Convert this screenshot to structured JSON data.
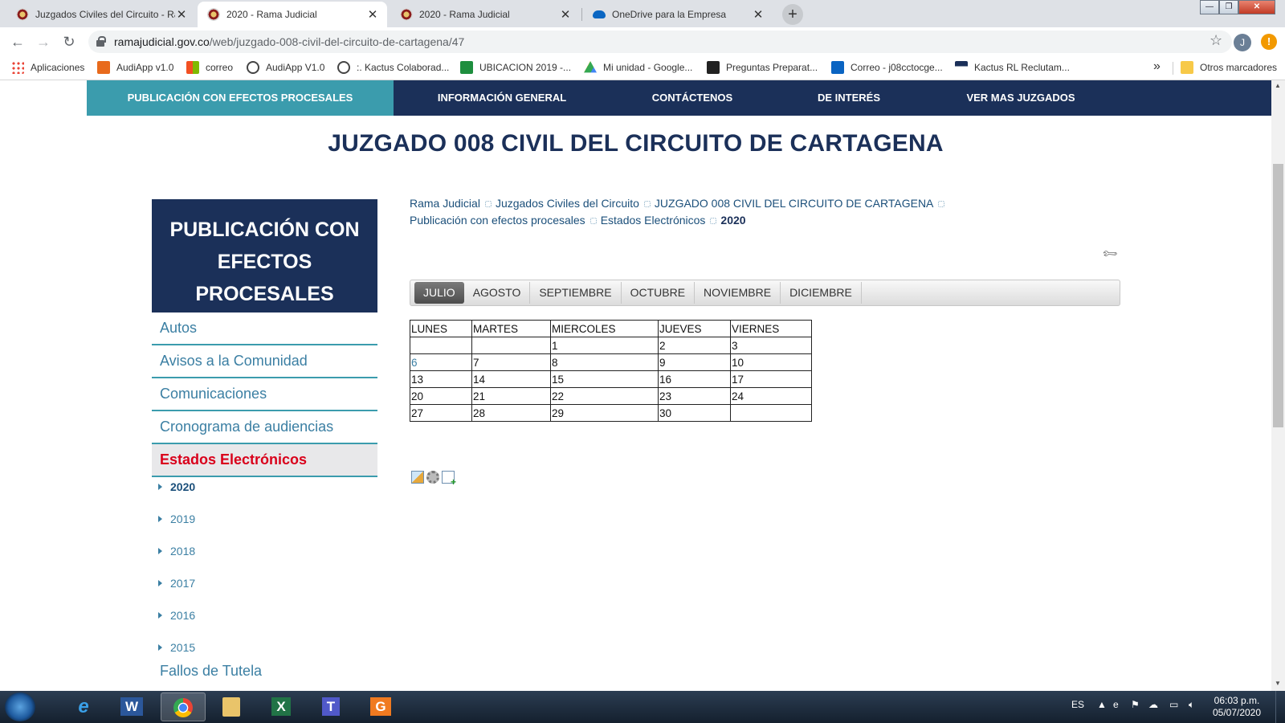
{
  "browser": {
    "tabs": [
      {
        "title": "Juzgados Civiles del Circuito - Ra",
        "active": false
      },
      {
        "title": "2020 - Rama Judicial",
        "active": true
      },
      {
        "title": "2020 - Rama Judicial",
        "active": false
      },
      {
        "title": "OneDrive para la Empresa",
        "active": false
      }
    ],
    "url_host": "ramajudicial.gov.co",
    "url_path": "/web/juzgado-008-civil-del-circuito-de-cartagena/47",
    "profile_initial": "J",
    "update_badge": "!",
    "bookmarks": [
      "Aplicaciones",
      "AudiApp v1.0",
      "correo",
      "AudiApp V1.0",
      ":. Kactus Colaborad...",
      "UBICACION 2019 -...",
      "Mi unidad - Google...",
      "Preguntas Preparat...",
      "Correo - j08cctocge...",
      "Kactus RL Reclutam..."
    ],
    "bookmarks_overflow": "»",
    "other_bookmarks": "Otros marcadores"
  },
  "site": {
    "nav": [
      "PUBLICACIÓN CON EFECTOS PROCESALES",
      "INFORMACIÓN GENERAL",
      "CONTÁCTENOS",
      "DE INTERÉS",
      "VER MAS JUZGADOS"
    ],
    "title": "JUZGADO 008 CIVIL DEL CIRCUITO DE CARTAGENA",
    "sidebar": {
      "header": "PUBLICACIÓN CON EFECTOS PROCESALES",
      "items": [
        "Autos",
        "Avisos a la Comunidad",
        "Comunicaciones",
        "Cronograma de audiencias",
        "Estados Electrónicos"
      ],
      "years": [
        "2020",
        "2019",
        "2018",
        "2017",
        "2016",
        "2015"
      ],
      "more": "Fallos de Tutela"
    },
    "breadcrumb": [
      "Rama Judicial",
      "Juzgados Civiles del Circuito",
      "JUZGADO 008 CIVIL DEL CIRCUITO DE CARTAGENA",
      "Publicación con efectos procesales",
      "Estados Electrónicos",
      "2020"
    ],
    "months": [
      "JULIO",
      "AGOSTO",
      "SEPTIEMBRE",
      "OCTUBRE",
      "NOVIEMBRE",
      "DICIEMBRE"
    ],
    "calendar": {
      "headers": [
        "LUNES",
        "MARTES",
        "MIERCOLES",
        "JUEVES",
        "VIERNES"
      ],
      "rows": [
        [
          "",
          "",
          "1",
          "2",
          "3"
        ],
        [
          "6",
          "7",
          "8",
          "9",
          "10"
        ],
        [
          "13",
          "14",
          "15",
          "16",
          "17"
        ],
        [
          "20",
          "21",
          "22",
          "23",
          "24"
        ],
        [
          "27",
          "28",
          "29",
          "30",
          ""
        ]
      ],
      "linked_days": [
        "6"
      ]
    }
  },
  "taskbar": {
    "language": "ES",
    "time": "06:03 p.m.",
    "date": "05/07/2020"
  }
}
